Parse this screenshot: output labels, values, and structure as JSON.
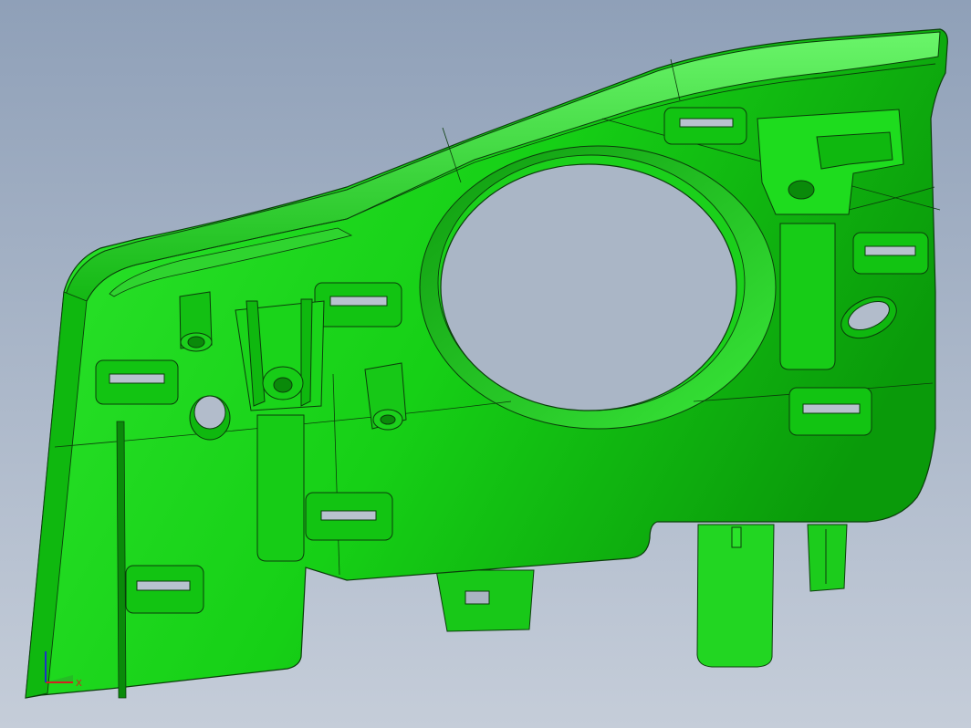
{
  "viewport": {
    "background_top": "#8fa0b8",
    "background_bottom": "#c5cdd9"
  },
  "part": {
    "color": "#19d419",
    "color_light": "#5af05a",
    "color_dark": "#0a8a0a",
    "edge_color": "#0b3d0b"
  },
  "triad": {
    "x_label": "X",
    "y_label": "Y",
    "x_color": "#d42020",
    "y_color": "#1a8a1a",
    "z_color": "#2030c8"
  }
}
